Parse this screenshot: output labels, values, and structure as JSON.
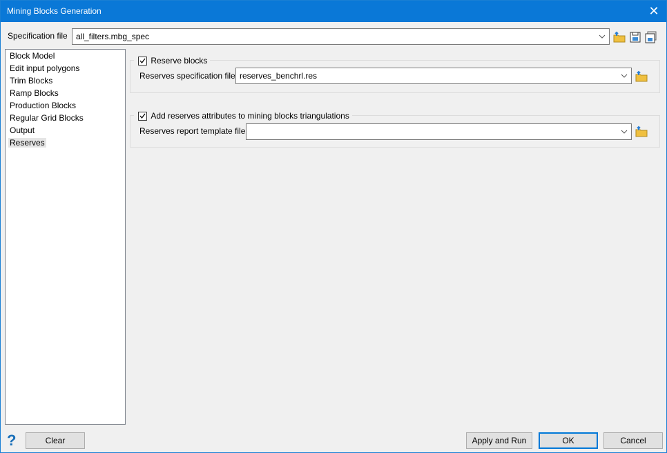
{
  "window": {
    "title": "Mining Blocks Generation"
  },
  "spec": {
    "label": "Specification file",
    "value": "all_filters.mbg_spec"
  },
  "tree": {
    "items": [
      "Block Model",
      "Edit input polygons",
      "Trim Blocks",
      "Ramp Blocks",
      "Production Blocks",
      "Regular Grid Blocks",
      "Output",
      "Reserves"
    ],
    "selected": "Reserves"
  },
  "reserve_blocks": {
    "label": "Reserve blocks",
    "checked": true,
    "file_label": "Reserves specification file",
    "file_value": "reserves_benchrl.res"
  },
  "add_attrs": {
    "label": "Add reserves attributes to mining blocks triangulations",
    "checked": true,
    "file_label": "Reserves report template file",
    "file_value": ""
  },
  "buttons": {
    "help": "?",
    "clear": "Clear",
    "apply_run": "Apply and Run",
    "ok": "OK",
    "cancel": "Cancel"
  },
  "colors": {
    "accent": "#0078d7",
    "folder": "#f0c040"
  }
}
